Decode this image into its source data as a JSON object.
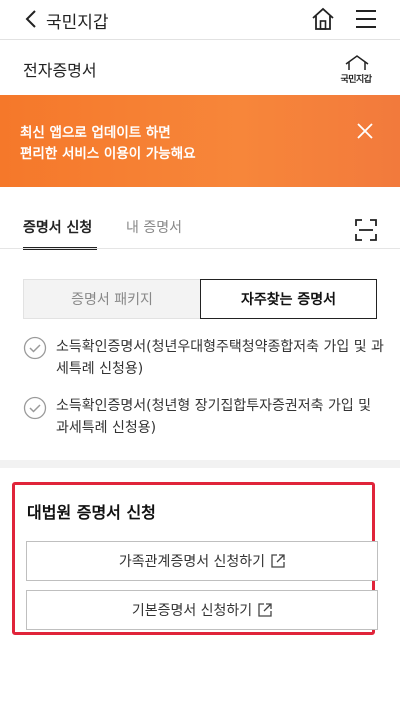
{
  "topbar": {
    "title": "국민지갑",
    "back_icon": "chevron-left-icon",
    "home_icon": "home-icon",
    "menu_icon": "hamburger-menu-icon"
  },
  "subheader": {
    "title": "전자증명서",
    "logo_text": "국민지갑"
  },
  "banner": {
    "line1": "최신 앱으로 업데이트 하면",
    "line2": "편리한 서비스 이용이 가능해요",
    "close_icon": "close-icon",
    "color": "#f5782a"
  },
  "tabs": [
    {
      "label": "증명서 신청",
      "active": true
    },
    {
      "label": "내 증명서",
      "active": false
    }
  ],
  "segment": {
    "left": "증명서 패키지",
    "right": "자주찾는 증명서",
    "selected": "자주찾는 증명서"
  },
  "cert_list": [
    {
      "text": "소득확인증명서(청년우대형주택청약종합저축 가입 및 과세특례 신청용)"
    },
    {
      "text": "소득확인증명서(청년형 장기집합투자증권저축 가입 및 과세특례 신청용)"
    }
  ],
  "court_section": {
    "title": "대법원 증명서 신청",
    "buttons": [
      {
        "label": "가족관계증명서 신청하기"
      },
      {
        "label": "기본증명서 신청하기"
      }
    ],
    "highlight_color": "#e0243a"
  }
}
